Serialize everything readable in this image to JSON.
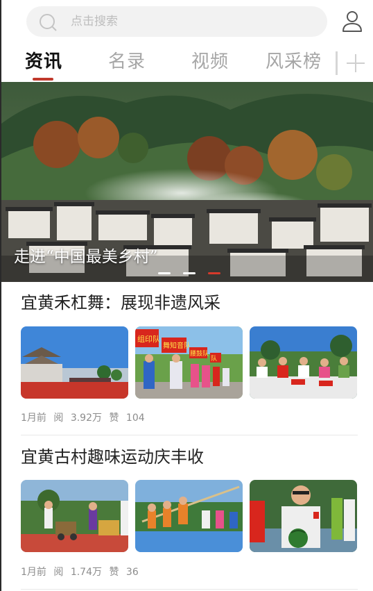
{
  "search": {
    "placeholder": "点击搜索"
  },
  "tabs": [
    {
      "label": "资讯",
      "active": true
    },
    {
      "label": "名录",
      "active": false
    },
    {
      "label": "视频",
      "active": false
    },
    {
      "label": "风采榜",
      "active": false
    }
  ],
  "accent_color": "#c0392b",
  "banner": {
    "caption": "走进“中国最美乡村”",
    "slide_count": 3,
    "active_slide": 3
  },
  "articles": [
    {
      "title": "宜黄禾杠舞：展现非遗风采",
      "time": "1月前",
      "views_label": "阅",
      "views": "3.92万",
      "likes_label": "赞",
      "likes": "104",
      "thumbs": [
        "stage-with-pagoda-image",
        "performers-with-red-banners-image",
        "judges-at-table-image"
      ],
      "thumb_texts": [
        "组印队",
        "舞知音队",
        "腰鼓队",
        "队"
      ]
    },
    {
      "title": "宜黄古村趣味运动庆丰收",
      "time": "1月前",
      "views_label": "阅",
      "views": "1.74万",
      "likes_label": "赞",
      "likes": "36",
      "thumbs": [
        "pushing-carts-race-image",
        "tug-of-war-image",
        "man-holding-watermelon-image"
      ]
    }
  ],
  "icons": {
    "search": "search-icon",
    "user": "user-icon",
    "add_channel": "plus-icon"
  }
}
